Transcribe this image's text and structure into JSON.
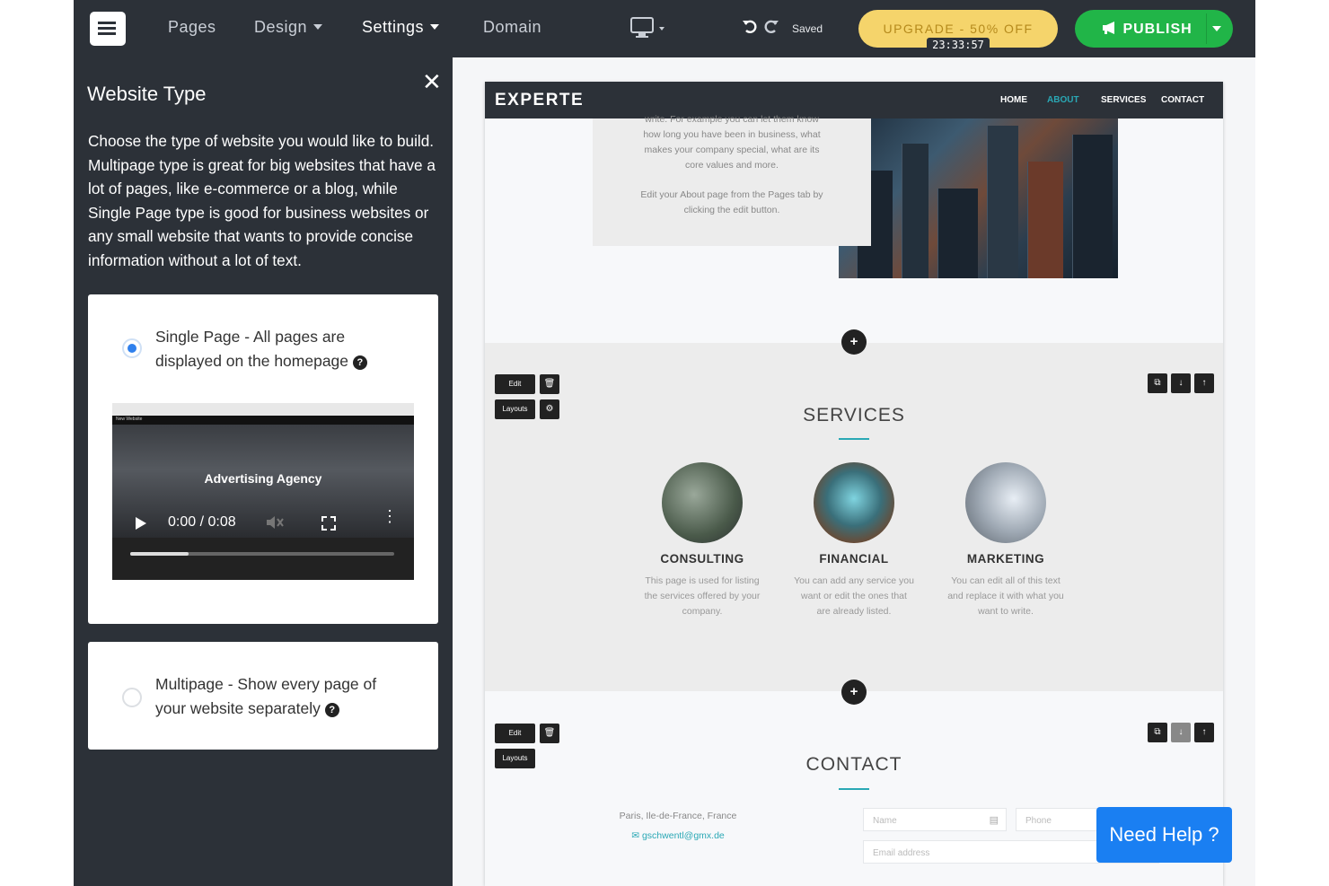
{
  "topbar": {
    "nav": [
      {
        "label": "Pages",
        "has_caret": false
      },
      {
        "label": "Design",
        "has_caret": true
      },
      {
        "label": "Settings",
        "has_caret": true
      },
      {
        "label": "Domain",
        "has_caret": false
      }
    ],
    "device_icon": "desktop-monitor-icon",
    "undo_icon": "undo-icon",
    "redo_icon": "redo-icon",
    "status": "Saved",
    "upgrade": {
      "label": "UPGRADE - 50% OFF",
      "timer": "23:33:57",
      "color": "#f5d46b"
    },
    "publish": {
      "label": "PUBLISH",
      "icon": "megaphone-icon",
      "color": "#21b548"
    }
  },
  "sidebar": {
    "title": "Website Type",
    "description": "Choose the type of website you would like to build. Multipage type is great for big websites that have a lot of pages, like e-commerce or a blog, while Single Page type is good for business websites or any small website that wants to provide concise information without a lot of text.",
    "options": [
      {
        "line1": "Single Page - All pages are",
        "line2": "displayed on the homepage",
        "selected": true
      },
      {
        "line1": "Multipage - Show every page of",
        "line2": "your website separately",
        "selected": false
      }
    ],
    "video": {
      "title": "Advertising Agency",
      "time": "0:00 / 0:08",
      "progress": 0.22
    }
  },
  "site": {
    "brand": "EXPERTE",
    "menu": [
      "HOME",
      "ABOUT",
      "SERVICES",
      "CONTACT"
    ],
    "active_menu": "ABOUT",
    "accent": "#2aa8b5",
    "about_lines": [
      "write. For example you can let them know",
      "how long you have been in business, what",
      "makes your company special, what are its",
      "core values and more.",
      "",
      "Edit your About page from the Pages tab by",
      "clicking the edit button."
    ],
    "tools": {
      "edit": "Edit",
      "layouts": "Layouts"
    },
    "services": {
      "title": "SERVICES",
      "items": [
        {
          "name": "CONSULTING",
          "desc": [
            "This page is used for listing",
            "the services offered by your",
            "company."
          ]
        },
        {
          "name": "FINANCIAL",
          "desc": [
            "You can add any service you",
            "want or edit the ones that",
            "are already listed."
          ]
        },
        {
          "name": "MARKETING",
          "desc": [
            "You can edit all of this text",
            "and replace it with what you",
            "want to write."
          ]
        }
      ]
    },
    "contact": {
      "title": "CONTACT",
      "address": "Paris, Ile-de-France, France",
      "email": "gschwentl@gmx.de",
      "name_placeholder": "Name",
      "phone_placeholder": "Phone",
      "email_placeholder": "Email address"
    }
  },
  "help": {
    "label": "Need Help ?",
    "color": "#1a7ff2"
  }
}
